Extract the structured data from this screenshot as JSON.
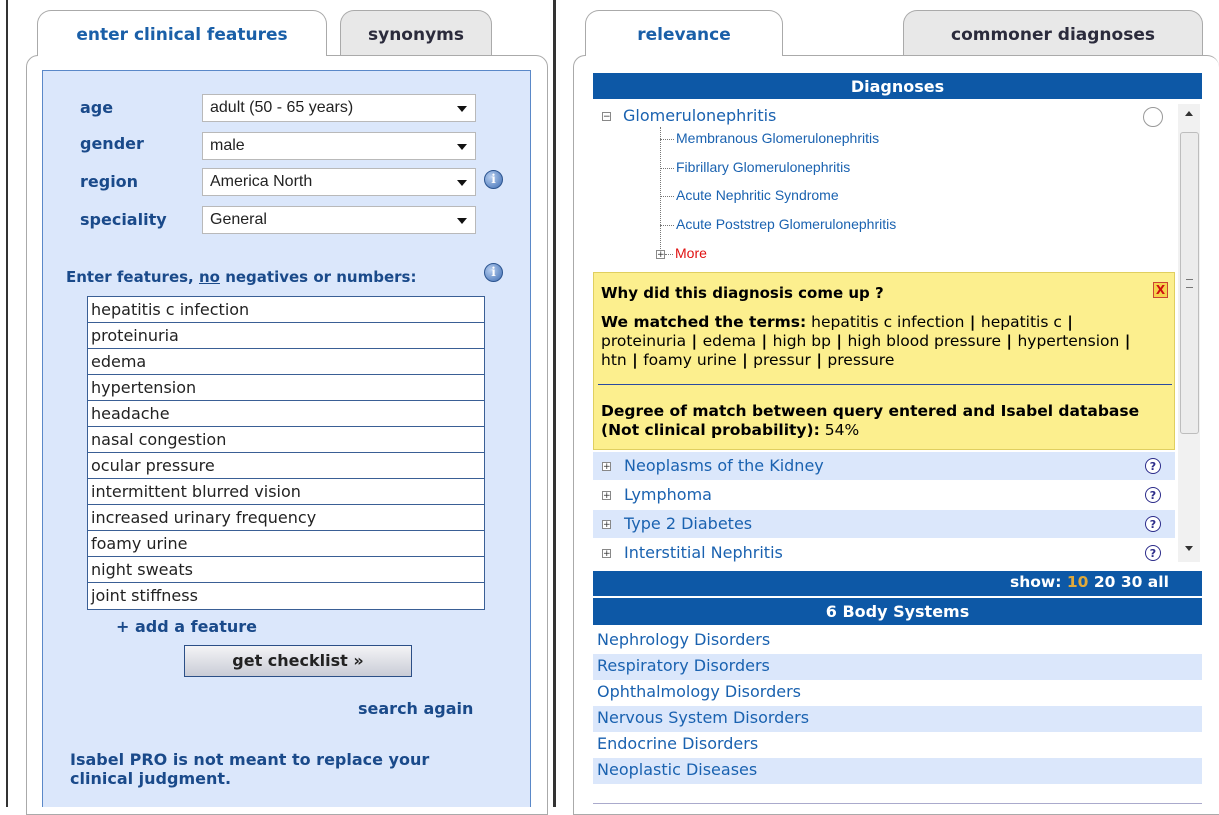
{
  "left_tabs": {
    "active": "enter clinical features",
    "inactive": "synonyms"
  },
  "right_tabs": {
    "active": "relevance",
    "inactive": "commoner diagnoses"
  },
  "form": {
    "age_label": "age",
    "age_value": "adult (50 - 65 years)",
    "gender_label": "gender",
    "gender_value": "male",
    "region_label": "region",
    "region_value": "America North",
    "speciality_label": "speciality",
    "speciality_value": "General",
    "features_prompt_pre": "Enter features, ",
    "features_prompt_no": "no",
    "features_prompt_post": " negatives or numbers:",
    "features": [
      "hepatitis c infection",
      "proteinuria",
      "edema",
      "hypertension",
      "headache",
      "nasal congestion",
      "ocular pressure",
      "intermittent blurred vision",
      "increased urinary frequency",
      "foamy urine",
      "night sweats",
      "joint stiffness"
    ],
    "add_feature": "+ add a feature",
    "get_checklist": "get checklist »",
    "search_again": "search again",
    "disclaimer": "Isabel PRO is not meant to replace your clinical judgment."
  },
  "diagnoses": {
    "header": "Diagnoses",
    "top": {
      "name": "Glomerulonephritis",
      "children": [
        "Membranous Glomerulonephritis",
        "Fibrillary Glomerulonephritis",
        "Acute Nephritic Syndrome",
        "Acute Poststrep Glomerulonephritis"
      ],
      "more": "More"
    },
    "why": {
      "title": "Why did this diagnosis come up ?",
      "close": "X",
      "matched_label": "We matched the terms:",
      "matched_terms": [
        "hepatitis c infection",
        "hepatitis c",
        "proteinuria",
        "edema",
        "high bp",
        "high blood pressure",
        "hypertension",
        "htn",
        "foamy urine",
        "pressur",
        "pressure"
      ],
      "degree_label": "Degree of match between query entered and Isabel database (Not clinical probability):",
      "degree_value": "54%"
    },
    "others": [
      "Neoplasms of the Kidney",
      "Lymphoma",
      "Type 2 Diabetes",
      "Interstitial Nephritis"
    ],
    "show_label": "show:",
    "show_options": [
      "10",
      "20",
      "30",
      "all"
    ],
    "show_selected": "10"
  },
  "body_systems": {
    "header": "6 Body Systems",
    "items": [
      "Nephrology Disorders",
      "Respiratory Disorders",
      "Ophthalmology Disorders",
      "Nervous System Disorders",
      "Endocrine Disorders",
      "Neoplastic Diseases"
    ]
  },
  "colors": {
    "accent": "#0d58a6",
    "panel_bg": "#dbe7fb",
    "highlight": "#fcef8e",
    "show_selected": "#e0a93a"
  }
}
